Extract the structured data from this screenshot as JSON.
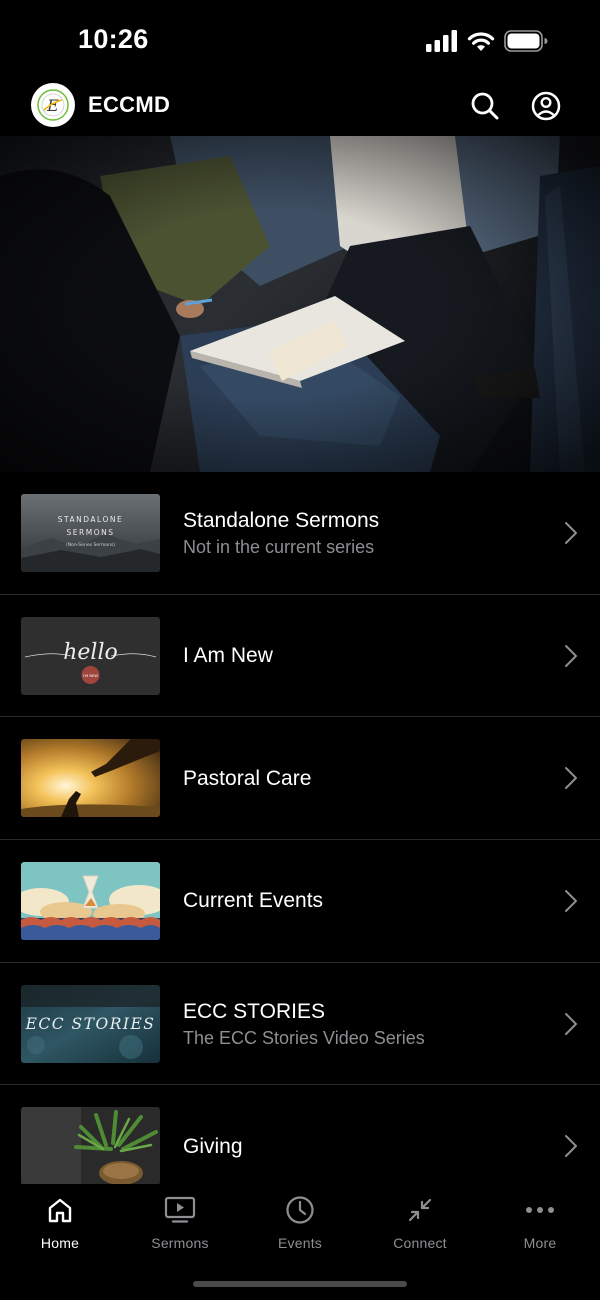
{
  "status_bar": {
    "time": "10:26"
  },
  "header": {
    "title": "ECCMD",
    "logo_letter": "E",
    "search_icon": "search-icon",
    "profile_icon": "person-circle-icon"
  },
  "items": [
    {
      "title": "Standalone Sermons",
      "subtitle": "Not in the current series",
      "thumb_lines": [
        "STANDALONE",
        "SERMONS",
        "(Non-Series Sermons)"
      ]
    },
    {
      "title": "I Am New",
      "subtitle": "",
      "thumb_lines": [
        "hello",
        "I'M NEW"
      ]
    },
    {
      "title": "Pastoral Care",
      "subtitle": ""
    },
    {
      "title": "Current Events",
      "subtitle": ""
    },
    {
      "title": "ECC STORIES",
      "subtitle": "The ECC Stories Video Series",
      "thumb_lines": [
        "ECC STORIES"
      ]
    },
    {
      "title": "Giving",
      "subtitle": ""
    }
  ],
  "tabs": [
    {
      "label": "Home",
      "icon": "home-icon",
      "active": true
    },
    {
      "label": "Sermons",
      "icon": "tv-play-icon",
      "active": false
    },
    {
      "label": "Events",
      "icon": "clock-icon",
      "active": false
    },
    {
      "label": "Connect",
      "icon": "arrows-in-icon",
      "active": false
    },
    {
      "label": "More",
      "icon": "ellipsis-icon",
      "active": false
    }
  ],
  "colors": {
    "background": "#000000",
    "active_tab": "#ffffff",
    "inactive_tab": "#8e8e93",
    "subtitle": "#8e8e93",
    "divider": "#2a2a2a"
  }
}
